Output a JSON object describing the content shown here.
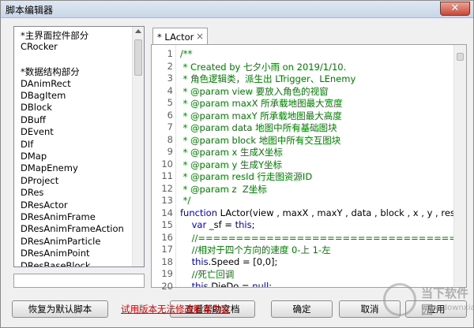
{
  "window": {
    "title": "脚本编辑器",
    "close_glyph": "✕"
  },
  "left_list": {
    "items": [
      "*主界面控件部分",
      "CRocker",
      "",
      "*数据结构部分",
      "DAnimRect",
      "DBagItem",
      "DBlock",
      "DBuff",
      "DEvent",
      "DIf",
      "DMap",
      "DMapEnemy",
      "DProject",
      "DRes",
      "DResActor",
      "DResAnimFrame",
      "DResAnimFrameAction",
      "DResAnimParticle",
      "DResAnimPoint",
      "DResBaseBlock"
    ]
  },
  "editor": {
    "tab_label": "* LActor",
    "tab_close": "×",
    "lines": [
      {
        "n": "1",
        "text": "/**",
        "kind": "cm"
      },
      {
        "n": "2",
        "text": " * Created by 七夕小雨 on 2019/1/10.",
        "kind": "cm"
      },
      {
        "n": "3",
        "text": " * 角色逻辑类，派生出 LTrigger、LEnemy",
        "kind": "cm"
      },
      {
        "n": "4",
        "text": " * @param view 要放入角色的视窗",
        "kind": "cm"
      },
      {
        "n": "5",
        "text": " * @param maxX 所承载地图最大宽度",
        "kind": "cm"
      },
      {
        "n": "6",
        "text": " * @param maxY 所承载地图最大高度",
        "kind": "cm"
      },
      {
        "n": "7",
        "text": " * @param data 地图中所有基础图块",
        "kind": "cm"
      },
      {
        "n": "8",
        "text": " * @param block 地图中所有交互图块",
        "kind": "cm"
      },
      {
        "n": "9",
        "text": " * @param x 生成X坐标",
        "kind": "cm"
      },
      {
        "n": "10",
        "text": " * @param y 生成Y坐标",
        "kind": "cm"
      },
      {
        "n": "11",
        "text": " * @param resId 行走图资源ID",
        "kind": "cm"
      },
      {
        "n": "12",
        "text": " * @param z  Z坐标",
        "kind": "cm"
      },
      {
        "n": "13",
        "text": " */",
        "kind": "cm"
      },
      {
        "n": "14",
        "text": "function LActor(view , maxX , maxY , data , block , x , y , resId,z){",
        "kind": "fn"
      },
      {
        "n": "15",
        "text": "    var _sf = this;",
        "kind": "var"
      },
      {
        "n": "16",
        "text": "    //================================== 公有",
        "kind": "cm"
      },
      {
        "n": "17",
        "text": "    //相对于四个方向的速度 0-上 1-左",
        "kind": "cm"
      },
      {
        "n": "18",
        "text": "    this.Speed = [0,0];",
        "kind": "this"
      },
      {
        "n": "19",
        "text": "    //死亡回调",
        "kind": "cm"
      },
      {
        "n": "20",
        "text": "    this.DieDo = null;",
        "kind": "this"
      }
    ]
  },
  "buttons": {
    "restore_default": "恢复为默认脚本",
    "help_doc": "查看帮助文档",
    "ok": "确定",
    "cancel": "取消",
    "apply": "应用"
  },
  "warning": "试用版本无法修改脚本内容",
  "watermark": {
    "brand": "当下软件园",
    "url": "www.downxia.com"
  }
}
